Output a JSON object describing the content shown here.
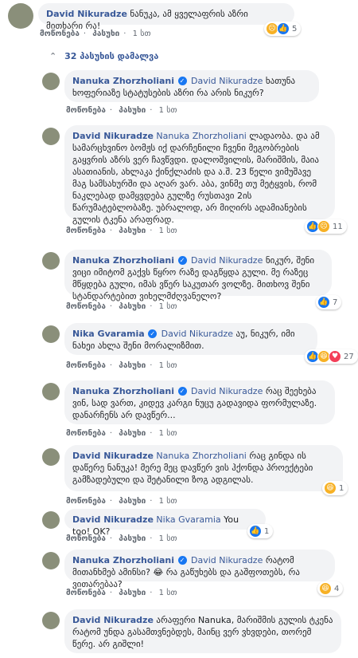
{
  "top_comment": {
    "author": "David Nikuradze",
    "text": "ნანუკა, ამ ყველაფრის აზრი მითხარი რა!",
    "like_label": "მოწონება",
    "reply_label": "პასუხი",
    "time": "1 სთ",
    "reaction_count": "5"
  },
  "view_replies": "32 პასუხის დამალვა",
  "replies": [
    {
      "author": "Nanuka Zhorzholiani",
      "mention": "David Nikuradze",
      "text": "ხათუნა ხოფერიაზე სტატუსების აზრი რა არის ნიკურ?",
      "like_label": "მოწონება",
      "reply_label": "პასუხი",
      "time": "1 სთ",
      "reaction_count": ""
    },
    {
      "author": "David Nikuradze",
      "mention": "Nanuka Zhorzholiani",
      "text": "ლადაობა. და ამ სამარცხვინო ბომჟს იქ დარჩენილი ჩვენი მეგობრების გაყვრის აზრს ვერ ჩავწვდი. დალოშვილის, მარიშმის, მაია ასათიანის, ახლაკა ქინქლაძის და ა.შ. 23 წელი ვიმუშავე მაგ სამსახურში და აღარ ვარ. აბა, ვინმე თუ მეტყვის, რომ ნაკლებად დამყვდება გულზე რუსთავი 2ის წარუმატებლობაზე. უბრალოდ, არ მიღირს ადამიანების გულის ტკენა არაფრად.",
      "like_label": "მოწონება",
      "reply_label": "პასუხი",
      "time": "1 სთ",
      "reaction_count": "11"
    },
    {
      "author": "Nanuka Zhorzholiani",
      "mention": "David Nikuradze",
      "text": "ნიკურ, შენი ვიცი იმიტომ გაქვს წყრო რაზე დაგწყდა გული. მე რაზეც მწყდება გული, იმას ვწერ საკუთარ ვოლზე. მითხოვ შენი სტანდარტებით ვიხელმძღვანელო?",
      "like_label": "მოწონება",
      "reply_label": "პასუხი",
      "time": "1 სთ",
      "reaction_count": "7"
    },
    {
      "author": "Nika Gvaramia",
      "mention": "David Nikuradze",
      "text": "აუ, ნიკურ, იმი ნახეი ახლა შენი მორალიზმით.",
      "like_label": "მოწონება",
      "reply_label": "პასუხი",
      "time": "1 სთ",
      "reaction_count": "27"
    },
    {
      "author": "Nanuka Zhorzholiani",
      "mention": "David Nikuradze",
      "text": "რაც შეეხება ვინ, სად ვართ, კიდევ კარგი ნუცუ გადავიდა ფორმულაზე. დანარჩენს არ დავწერ...",
      "like_label": "მოწონება",
      "reply_label": "პასუხი",
      "time": "1 სთ",
      "reaction_count": ""
    },
    {
      "author": "David Nikuradze",
      "mention": "Nanuka Zhorzholiani",
      "text": "რაც გინდა ის დაწერე ნანუკა! მერე მეც დავწერ ვის ჰქონდა პროექტები გამზადებული და შეტანილი ზოგ ადგილას.",
      "like_label": "მოწონება",
      "reply_label": "პასუხი",
      "time": "1 სთ",
      "reaction_count": "1"
    },
    {
      "author": "David Nikuradze",
      "mention": "Nika Gvaramia",
      "text": "You too! OK?",
      "like_label": "მოწონება",
      "reply_label": "პასუხი",
      "time": "1 სთ",
      "reaction_count": "1"
    },
    {
      "author": "Nanuka Zhorzholiani",
      "mention": "David Nikuradze",
      "text": "რატომ მითანხმებ ამინსი? 😂 რა გაწუხებს და გაშფოთებს, რა ვითარებაა?",
      "like_label": "მოწონება",
      "reply_label": "პასუხი",
      "time": "1 სთ",
      "reaction_count": "4"
    },
    {
      "author": "David Nikuradze",
      "mention": "Nanuka",
      "text": "არაფერი Nanuka, მარიშმის გულის ტკენა რატომ უნდა გასამთვნებდეს, მაინც ვერ ვხვდები, თორემ წერე. არ გიშლი!",
      "like_label": "",
      "reply_label": "",
      "time": "",
      "reaction_count": ""
    }
  ]
}
